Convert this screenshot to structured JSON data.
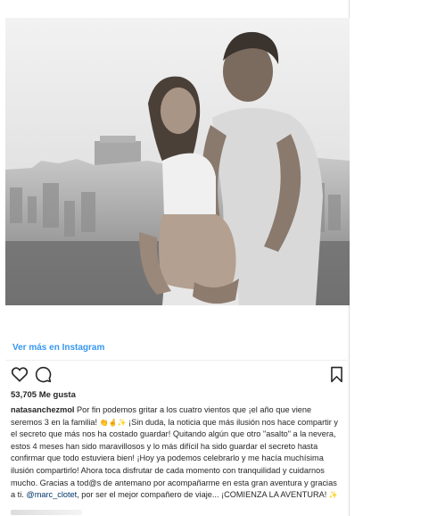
{
  "post": {
    "view_more_label": "Ver más en Instagram",
    "likes": "53,705 Me gusta",
    "username": "natasanchezmol",
    "caption_parts": {
      "p1": "Por fin podemos gritar a los cuatro vientos que ¡el año que viene seremos 3 en la familia!",
      "emoji1": "👏🤞✨",
      "p2": "¡Sin duda, la noticia que más ilusión nos hace compartir y el secreto que más nos ha costado guardar! Quitando algún que otro \"asalto\" a la nevera, estos 4 meses han sido maravillosos y lo más difícil ha sido guardar el secreto hasta confirmar que todo estuviera bien! ¡Hoy ya podemos celebrarlo y me hacía muchísima ilusión compartirlo! Ahora toca disfrutar de cada momento con tranquilidad y cuidarnos mucho. Gracias a tod@s de antemano por acompañarme en esta gran aventura y gracias a ti.",
      "mention": "@marc_clotet",
      "p3": ", por ser el mejor compañero de viaje... ¡COMIENZA LA AVENTURA!",
      "emoji2": "✨"
    },
    "icons": {
      "like": "heart-icon",
      "comment": "comment-icon",
      "save": "bookmark-icon"
    },
    "colors": {
      "link_blue": "#3897f0",
      "mention_blue": "#003569",
      "text": "#262626",
      "divider": "#efefef"
    }
  }
}
